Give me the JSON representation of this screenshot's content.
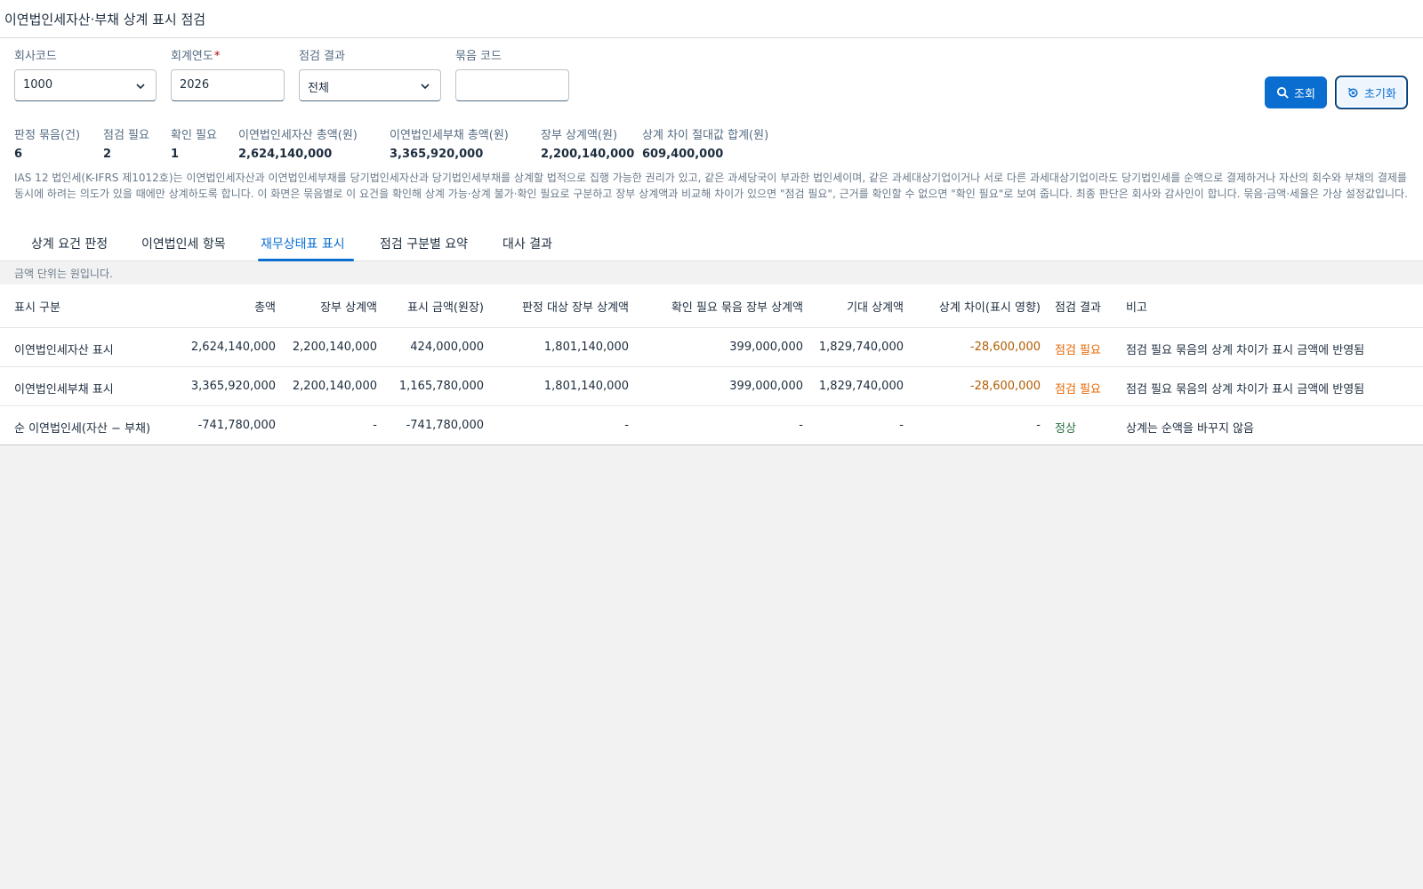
{
  "header": {
    "title": "이연법인세자산·부채 상계 표시 점검"
  },
  "filters": {
    "company": {
      "label": "회사코드",
      "value": "1000"
    },
    "year": {
      "label": "회계연도",
      "required_mark": "*",
      "value": "2026"
    },
    "result": {
      "label": "점검 결과",
      "value": "전체"
    },
    "group": {
      "label": "묶음 코드",
      "value": ""
    }
  },
  "actions": {
    "search_label": "조회",
    "reset_label": "초기화"
  },
  "kpis": [
    {
      "label": "판정 묶음(건)",
      "value": "6"
    },
    {
      "label": "점검 필요",
      "value": "2"
    },
    {
      "label": "확인 필요",
      "value": "1"
    },
    {
      "label": "이연법인세자산 총액(원)",
      "value": "2,624,140,000"
    },
    {
      "label": "이연법인세부채 총액(원)",
      "value": "3,365,920,000"
    },
    {
      "label": "장부 상계액(원)",
      "value": "2,200,140,000"
    },
    {
      "label": "상계 차이 절대값 합계(원)",
      "value": "609,400,000"
    }
  ],
  "description": "IAS 12 법인세(K-IFRS 제1012호)는 이연법인세자산과 이연법인세부채를 당기법인세자산과 당기법인세부채를 상계할 법적으로 집행 가능한 권리가 있고, 같은 과세당국이 부과한 법인세이며, 같은 과세대상기업이거나 서로 다른 과세대상기업이라도 당기법인세를 순액으로 결제하거나 자산의 회수와 부채의 결제를 동시에 하려는 의도가 있을 때에만 상계하도록 합니다. 이 화면은 묶음별로 이 요건을 확인해 상계 가능·상계 불가·확인 필요로 구분하고 장부 상계액과 비교해 차이가 있으면 \"점검 필요\", 근거를 확인할 수 없으면 \"확인 필요\"로 보여 줍니다. 최종 판단은 회사와 감사인이 합니다. 묶음·금액·세율은 가상 설정값입니다.",
  "tabs": [
    {
      "label": "상계 요건 판정"
    },
    {
      "label": "이연법인세 항목"
    },
    {
      "label": "재무상태표 표시"
    },
    {
      "label": "점검 구분별 요약"
    },
    {
      "label": "대사 결과"
    }
  ],
  "active_tab": "재무상태표 표시",
  "unit_note": "금액 단위는 원입니다.",
  "table": {
    "columns": [
      "표시 구분",
      "총액",
      "장부 상계액",
      "표시 금액(원장)",
      "판정 대상 장부 상계액",
      "확인 필요 묶음 장부 상계액",
      "기대 상계액",
      "상계 차이(표시 영향)",
      "점검 결과",
      "비고"
    ],
    "rows": [
      [
        "이연법인세자산 표시",
        "2,624,140,000",
        "2,200,140,000",
        "424,000,000",
        "1,801,140,000",
        "399,000,000",
        "1,829,740,000",
        "-28,600,000",
        "점검 필요",
        "점검 필요 묶음의 상계 차이가 표시 금액에 반영됨"
      ],
      [
        "이연법인세부채 표시",
        "3,365,920,000",
        "2,200,140,000",
        "1,165,780,000",
        "1,801,140,000",
        "399,000,000",
        "1,829,740,000",
        "-28,600,000",
        "점검 필요",
        "점검 필요 묶음의 상계 차이가 표시 금액에 반영됨"
      ],
      [
        "순 이연법인세(자산 − 부채)",
        "-741,780,000",
        "-",
        "-741,780,000",
        "-",
        "-",
        "-",
        "-",
        "정상",
        "상계는 순액을 바꾸지 않음"
      ]
    ]
  },
  "colors": {
    "accent": "#0a6ed1",
    "warning": "#e76500",
    "negative": "#b05c00",
    "positive": "#256f3a"
  }
}
